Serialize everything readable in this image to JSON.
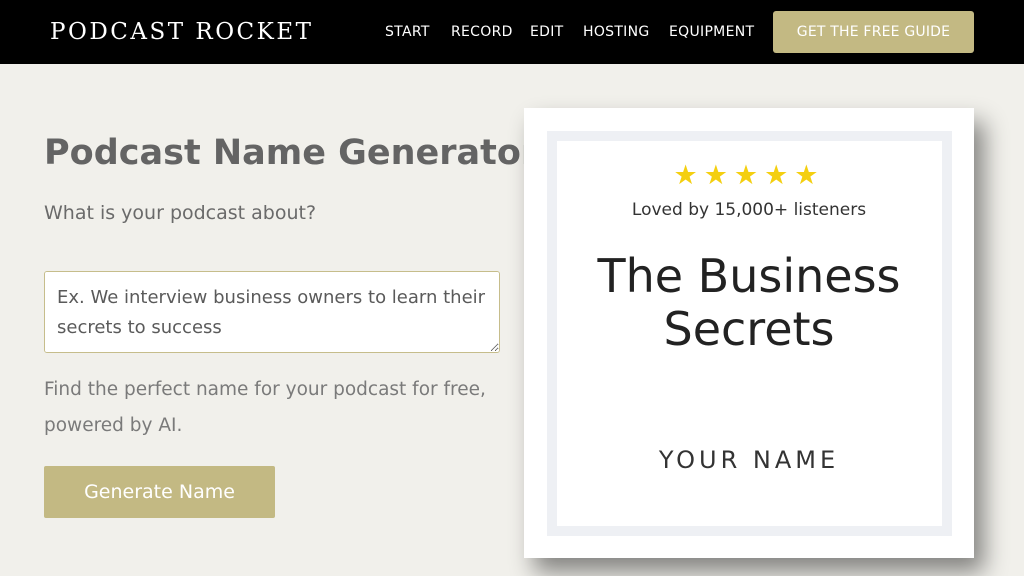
{
  "nav": {
    "logo": "PODCAST ROCKET",
    "items": [
      "START",
      "RECORD",
      "EDIT",
      "HOSTING",
      "EQUIPMENT"
    ],
    "cta_label": "GET THE FREE GUIDE"
  },
  "main": {
    "title": "Podcast Name Generator",
    "question": "What is your podcast about?",
    "input_placeholder": "Ex. We interview business owners to learn their secrets to success",
    "input_value": "",
    "description": "Find the perfect name for your podcast for free, powered by AI.",
    "generate_label": "Generate Name"
  },
  "preview": {
    "stars": "★★★★★",
    "rating_text": "Loved by 15,000+ listeners",
    "cover_title": "The Business Secrets",
    "author": "YOUR NAME"
  },
  "colors": {
    "accent": "#c3b983",
    "star": "#f4cf10",
    "background": "#f1f0eb",
    "nav_bg": "#000000"
  }
}
